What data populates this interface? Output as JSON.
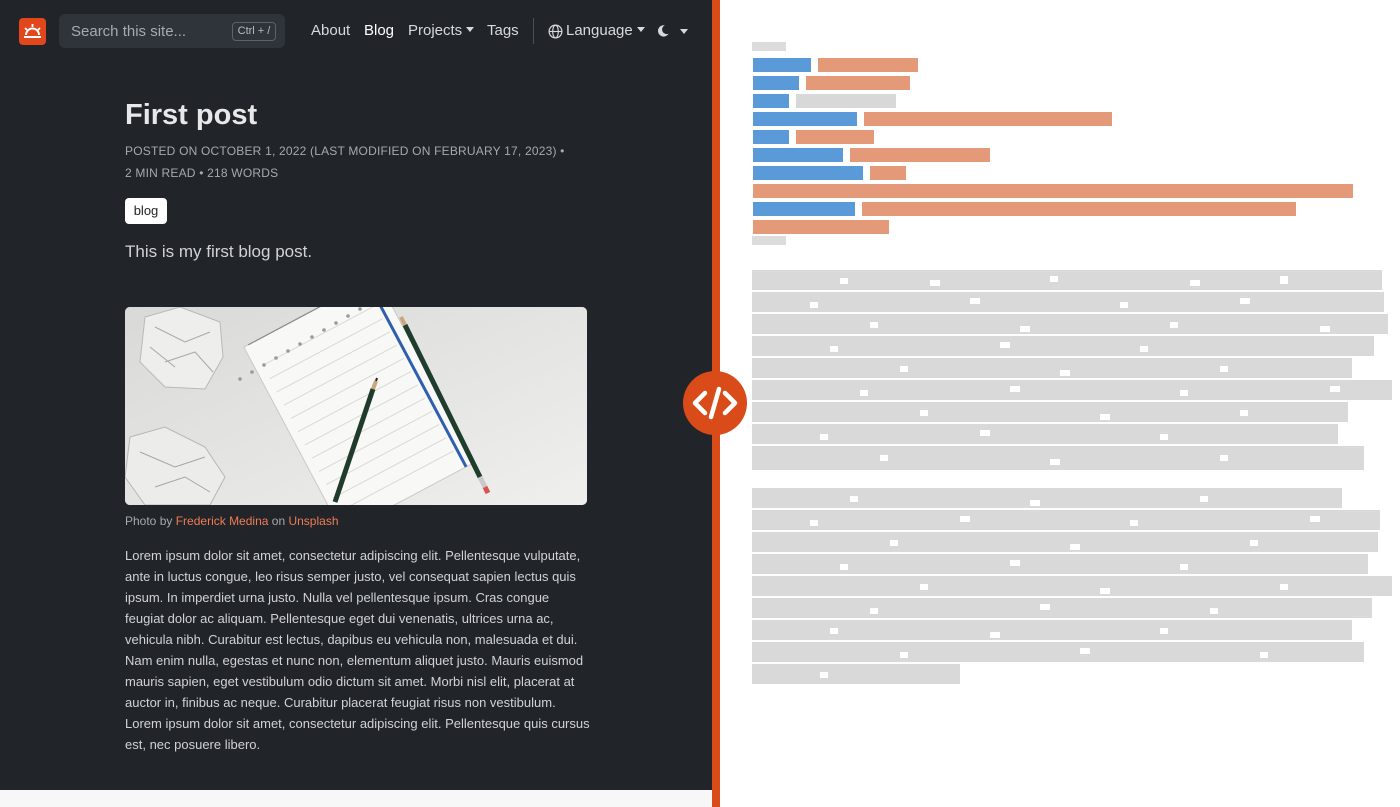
{
  "navbar": {
    "search_placeholder": "Search this site...",
    "search_shortcut": "Ctrl + /",
    "links": [
      {
        "label": "About",
        "active": false,
        "dropdown": false
      },
      {
        "label": "Blog",
        "active": true,
        "dropdown": false
      },
      {
        "label": "Projects",
        "active": false,
        "dropdown": true
      },
      {
        "label": "Tags",
        "active": false,
        "dropdown": false
      }
    ],
    "language_label": "Language",
    "icons": {
      "logo": "sunrise-logo-icon",
      "globe": "globe-icon",
      "theme": "moon-icon"
    }
  },
  "post": {
    "title": "First post",
    "meta_line1": "POSTED ON OCTOBER 1, 2022 (LAST MODIFIED ON FEBRUARY 17, 2023) •",
    "meta_line2": "2 MIN READ • 218 WORDS",
    "tag": "blog",
    "description": "This is my first blog post.",
    "caption_prefix": "Photo by",
    "caption_author": "Frederick Medina",
    "caption_mid": "on",
    "caption_source": "Unsplash",
    "body": "Lorem ipsum dolor sit amet, consectetur adipiscing elit. Pellentesque vulputate, ante in luctus congue, leo risus semper justo, vel consequat sapien lectus quis ipsum. In imperdiet urna justo. Nulla vel pellentesque ipsum. Cras congue feugiat dolor ac aliquam. Pellentesque eget dui venenatis, ultrices urna ac, vehicula nibh. Curabitur est lectus, dapibus eu vehicula non, malesuada et dui. Nam enim nulla, egestas et nunc non, elementum aliquet justo. Mauris euismod mauris sapien, eget vestibulum odio dictum sit amet. Morbi nisl elit, placerat at auctor in, finibus ac neque. Curabitur placerat feugiat risus non vestibulum. Lorem ipsum dolor sit amet, consectetur adipiscing elit. Pellentesque quis cursus est, nec posuere libero."
  },
  "colors": {
    "page_bg": "#212429",
    "accent": "#d94b18",
    "link": "#f07c55",
    "frontmatter_key": "#4a90d9",
    "frontmatter_value": "#e0896a",
    "source_text": "#d8d8d8"
  },
  "divider_icon": "code-brackets-icon"
}
